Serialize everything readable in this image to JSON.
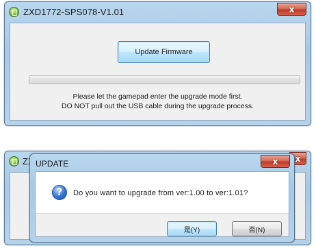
{
  "main_window": {
    "title": "ZXD1772-SPS078-V1.01",
    "close_glyph": "x",
    "update_button_label": "Update Firmware",
    "progress_fraction": 0.0,
    "message_line_1": "Please let the gamepad enter the upgrade mode first.",
    "message_line_2": "DO NOT pull out the USB cable during the upgrade process."
  },
  "background_window": {
    "title_fragment": "ZX",
    "close_glyph": "x"
  },
  "update_dialog": {
    "title": "UPDATE",
    "close_glyph": "x",
    "icon": "question-icon",
    "icon_glyph": "?",
    "question": "Do you want to upgrade from ver:1.00 to ver:1.01?",
    "yes_label": "是(Y)",
    "no_label": "否(N)"
  },
  "colors": {
    "titlebar": "#b9d6ee",
    "close_button": "#c0392b",
    "client_bg": "#f0f0f0",
    "progress_fill": "#37c12a",
    "question_icon": "#3a79d9"
  }
}
